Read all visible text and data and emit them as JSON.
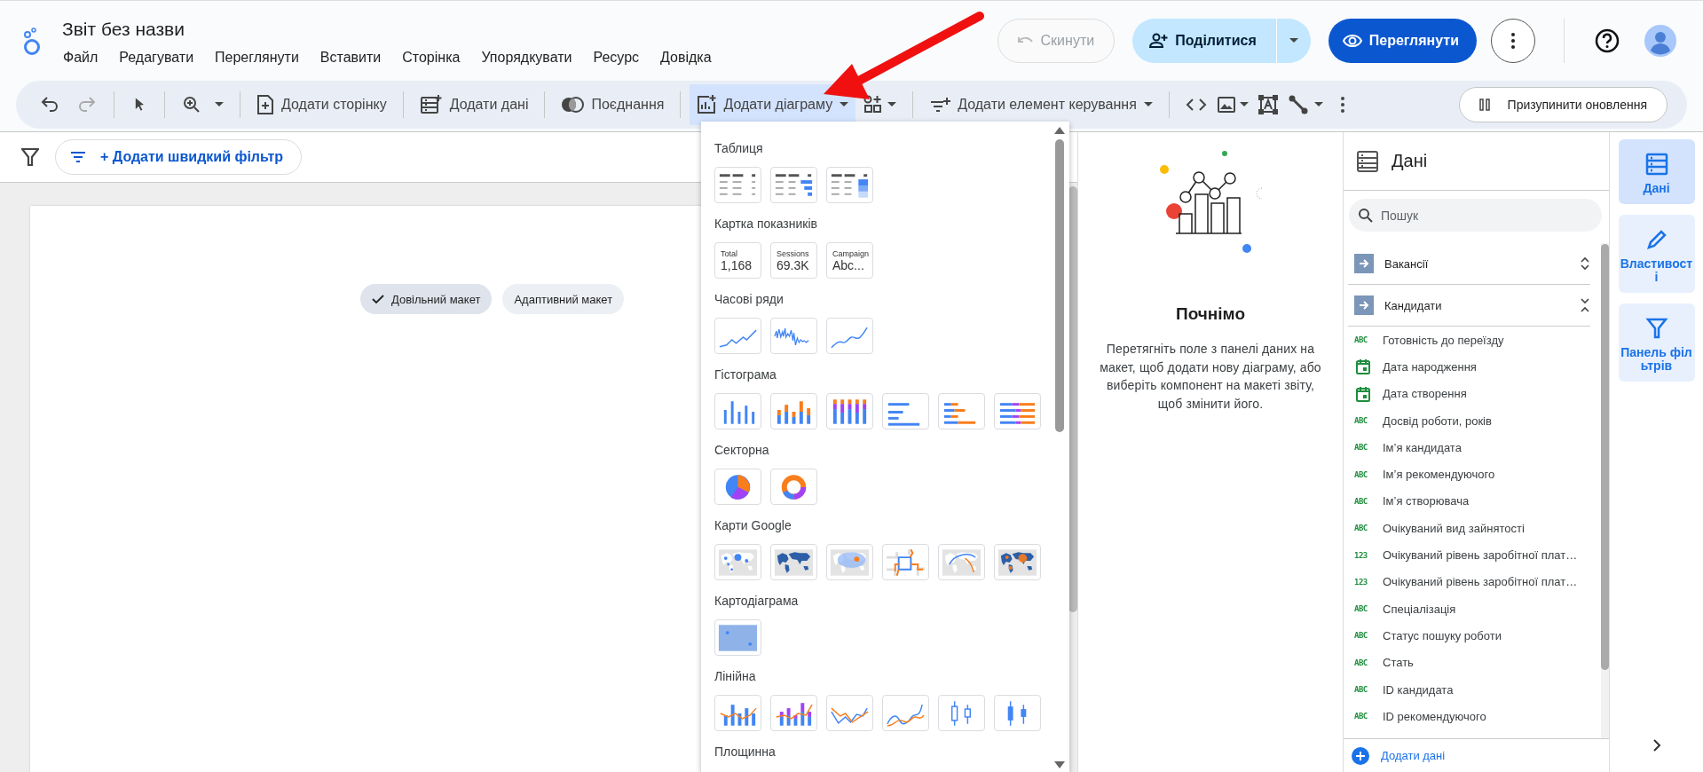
{
  "header": {
    "title": "Звіт без назви",
    "menu": [
      "Файл",
      "Редагувати",
      "Переглянути",
      "Вставити",
      "Сторінка",
      "Упорядкувати",
      "Ресурс",
      "Довідка"
    ],
    "reset_button": {
      "label": "Скинути",
      "disabled": true
    },
    "share_button": {
      "label": "Поділитися"
    },
    "view_button": {
      "label": "Переглянути"
    }
  },
  "toolbar": {
    "items": [
      {
        "label": "Додати сторінку",
        "kind": "button"
      },
      {
        "label": "Додати дані",
        "kind": "button"
      },
      {
        "label": "Поєднання",
        "kind": "button"
      },
      {
        "label": "Додати діаграму",
        "kind": "dropdown",
        "expanded": true
      },
      {
        "label": "Додати елемент керування",
        "kind": "dropdown",
        "expanded": false
      }
    ],
    "pause_button": "Призупинити оновлення"
  },
  "filter_bar": {
    "quick_filter_button": "+ Додати швидкий фільтр"
  },
  "layout_options": [
    {
      "label": "Довільний макет",
      "selected": true
    },
    {
      "label": "Адаптивний макет",
      "selected": false
    }
  ],
  "chart_menu": {
    "sections": [
      {
        "title": "Таблиця",
        "items": [
          {
            "kind": "table"
          },
          {
            "kind": "table-bars"
          },
          {
            "kind": "table-heatmap"
          }
        ]
      },
      {
        "title": "Картка показників",
        "items": [
          {
            "kind": "scorecard",
            "label": "Total",
            "value": "1,168"
          },
          {
            "kind": "scorecard",
            "label": "Sessions",
            "value": "69.3K"
          },
          {
            "kind": "scorecard",
            "label": "Campaign",
            "value": "Abc..."
          }
        ]
      },
      {
        "title": "Часові ряди",
        "items": [
          {
            "kind": "line-sharp"
          },
          {
            "kind": "line-noisy"
          },
          {
            "kind": "line-smooth"
          }
        ]
      },
      {
        "title": "Гістограма",
        "items": [
          {
            "kind": "column"
          },
          {
            "kind": "column-stacked"
          },
          {
            "kind": "column-100"
          },
          {
            "kind": "bar"
          },
          {
            "kind": "bar-stacked"
          },
          {
            "kind": "bar-100"
          }
        ]
      },
      {
        "title": "Секторна",
        "items": [
          {
            "kind": "pie"
          },
          {
            "kind": "donut"
          }
        ]
      },
      {
        "title": "Карти Google",
        "items": [
          {
            "kind": "map-bubble"
          },
          {
            "kind": "map-filled"
          },
          {
            "kind": "map-heat"
          },
          {
            "kind": "map-route"
          },
          {
            "kind": "map-arc"
          },
          {
            "kind": "map-mixed"
          }
        ]
      },
      {
        "title": "Картодіаграма",
        "items": [
          {
            "kind": "map-choropleth"
          }
        ]
      },
      {
        "title": "Лінійна",
        "items": [
          {
            "kind": "combo"
          },
          {
            "kind": "combo-stacked"
          },
          {
            "kind": "line-pair"
          },
          {
            "kind": "smooth-pair"
          },
          {
            "kind": "candle"
          },
          {
            "kind": "candle-filled"
          }
        ]
      },
      {
        "title": "Площинна"
      }
    ]
  },
  "start_panel": {
    "title": "Почнімо",
    "text": "Перетягніть поле з панелі даних на макет, щоб додати нову діаграму, або виберіть компонент на макеті звіту, щоб змінити його."
  },
  "data_panel": {
    "title": "Дані",
    "search": {
      "placeholder": "Пошук"
    },
    "sources": [
      {
        "name": "Вакансії",
        "expanded": false
      },
      {
        "name": "Кандидати",
        "expanded": true
      }
    ],
    "fields": [
      {
        "kind": "text",
        "badge": "ABC",
        "name": "Готовність до переїзду"
      },
      {
        "kind": "date",
        "name": "Дата народження"
      },
      {
        "kind": "date",
        "name": "Дата створення"
      },
      {
        "kind": "text",
        "badge": "ABC",
        "name": "Досвід роботи, років"
      },
      {
        "kind": "text",
        "badge": "ABC",
        "name": "Ім’я кандидата"
      },
      {
        "kind": "text",
        "badge": "ABC",
        "name": "Ім’я рекомендуючого"
      },
      {
        "kind": "text",
        "badge": "ABC",
        "name": "Ім’я створювача"
      },
      {
        "kind": "text",
        "badge": "ABC",
        "name": "Очікуваний вид зайнятості"
      },
      {
        "kind": "number",
        "badge": "123",
        "name": "Очікуваний рівень заробітної плат…"
      },
      {
        "kind": "number",
        "badge": "123",
        "name": "Очікуваний рівень заробітної плат…"
      },
      {
        "kind": "text",
        "badge": "ABC",
        "name": "Спеціалізація"
      },
      {
        "kind": "text",
        "badge": "ABC",
        "name": "Статус пошуку роботи"
      },
      {
        "kind": "text",
        "badge": "ABC",
        "name": "Стать"
      },
      {
        "kind": "text",
        "badge": "ABC",
        "name": "ID кандидата"
      },
      {
        "kind": "text",
        "badge": "ABC",
        "name": "ID рекомендуючого"
      }
    ],
    "add_data_button": "Додати дані"
  },
  "side_rail": [
    {
      "label": "Дані",
      "selected": true
    },
    {
      "label": "Властивості",
      "selected": false
    },
    {
      "label": "Панель фільтрів",
      "selected": false
    }
  ]
}
